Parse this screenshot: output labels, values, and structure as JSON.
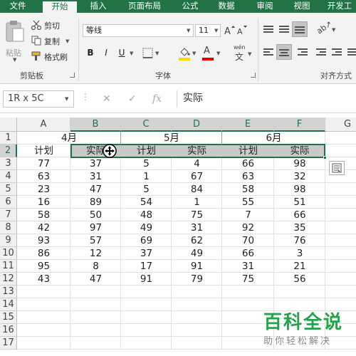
{
  "ribbon_tabs": [
    "文件",
    "开始",
    "插入",
    "页面布局",
    "公式",
    "数据",
    "审阅",
    "视图",
    "开发工"
  ],
  "clipboard": {
    "paste": "粘贴",
    "cut": "剪切",
    "copy": "复制",
    "format_painter": "格式刷",
    "group": "剪贴板"
  },
  "font": {
    "name": "等线",
    "size": "11",
    "group": "字体",
    "bold": "B",
    "italic": "I",
    "underline": "U",
    "phonetic": "wén",
    "phonetic_char": "文",
    "font_color_char": "A"
  },
  "alignment": {
    "group": "对齐方式"
  },
  "formula_bar": {
    "name_box": "1R x 5C",
    "content": "实际",
    "fx": "fx"
  },
  "columns": [
    "A",
    "B",
    "C",
    "D",
    "E",
    "F",
    "G"
  ],
  "rows": [
    "1",
    "2",
    "3",
    "4",
    "5",
    "6",
    "7",
    "8",
    "9",
    "10",
    "11",
    "12",
    "13",
    "14",
    "15",
    "16",
    "17"
  ],
  "months": [
    "4月",
    "5月",
    "6月"
  ],
  "headers": [
    "计划",
    "实际",
    "计划",
    "实际",
    "计划",
    "实际"
  ],
  "data_rows": [
    [
      "77",
      "37",
      "5",
      "4",
      "66",
      "98"
    ],
    [
      "63",
      "31",
      "1",
      "67",
      "63",
      "32"
    ],
    [
      "23",
      "47",
      "5",
      "84",
      "58",
      "98"
    ],
    [
      "16",
      "89",
      "54",
      "1",
      "55",
      "51"
    ],
    [
      "58",
      "50",
      "48",
      "75",
      "7",
      "66"
    ],
    [
      "42",
      "97",
      "49",
      "31",
      "92",
      "35"
    ],
    [
      "93",
      "57",
      "69",
      "62",
      "70",
      "76"
    ],
    [
      "86",
      "12",
      "37",
      "49",
      "66",
      "3"
    ],
    [
      "95",
      "8",
      "17",
      "91",
      "31",
      "21"
    ],
    [
      "43",
      "47",
      "91",
      "79",
      "75",
      "56"
    ]
  ],
  "watermark": {
    "title": "百科全说",
    "subtitle": "助你轻松解决"
  },
  "colors": {
    "excel_green": "#217346",
    "watermark_green": "#25a24a",
    "selection_gray": "#c9c9c9"
  }
}
